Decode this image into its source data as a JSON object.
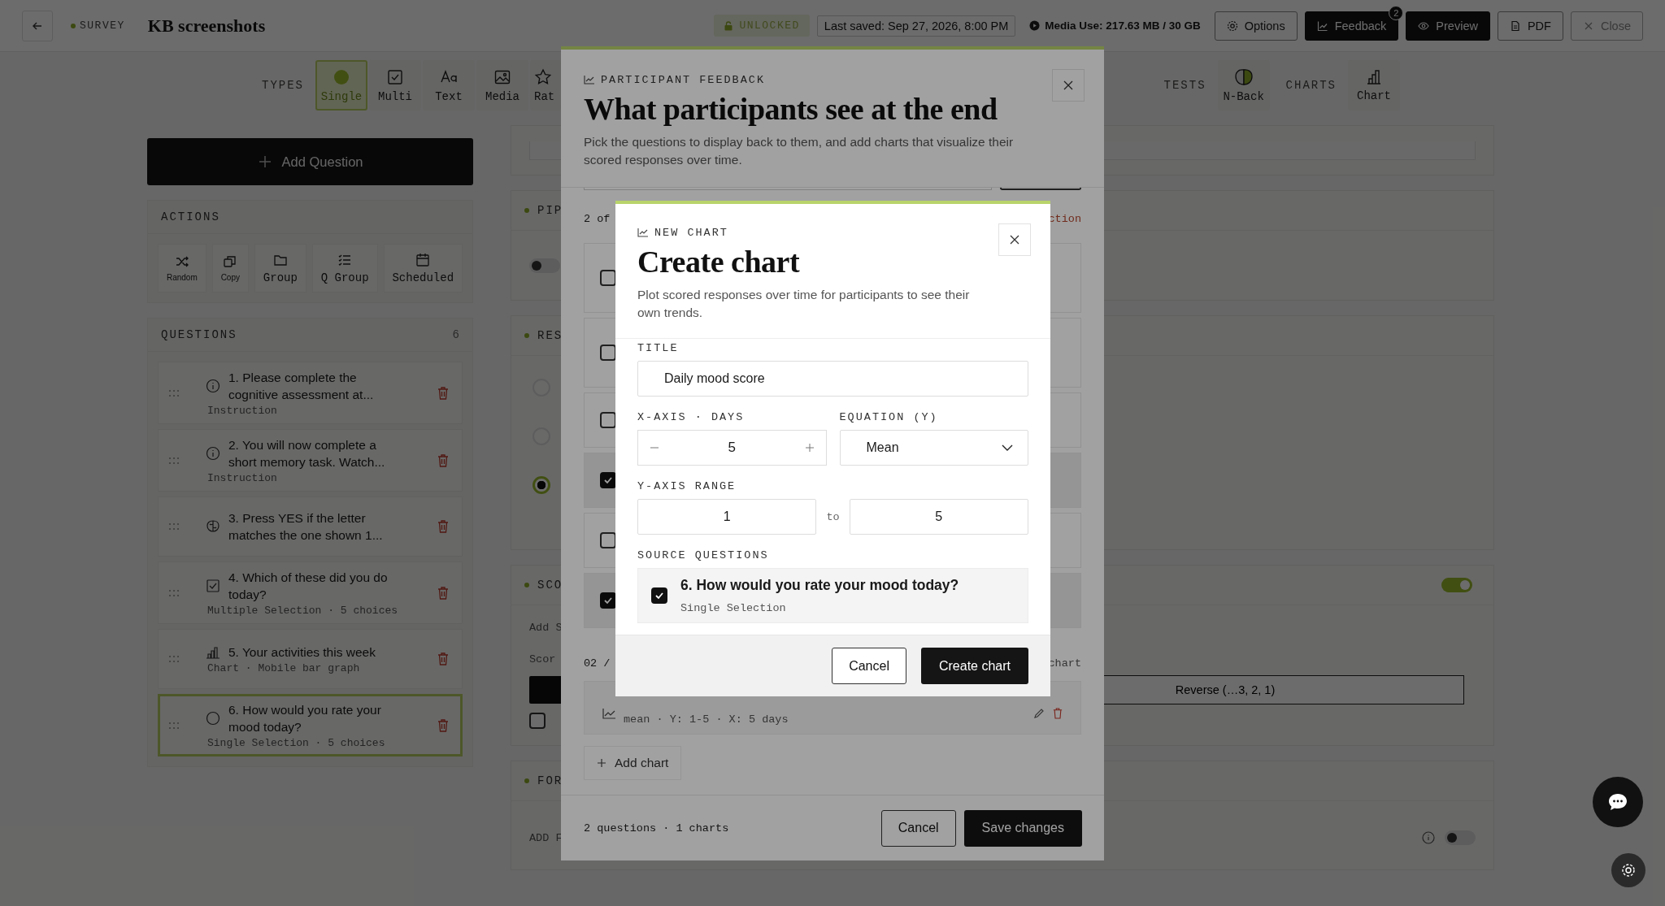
{
  "topbar": {
    "section": "SURVEY",
    "title": "KB screenshots",
    "status": "UNLOCKED",
    "last_saved": "Last saved: Sep 27, 2026, 8:00 PM",
    "media_use": "Media Use: 217.63 MB / 30 GB",
    "buttons": [
      {
        "label": "Options",
        "kind": "outline"
      },
      {
        "label": "Feedback",
        "kind": "dark",
        "badge": "2"
      },
      {
        "label": "Preview",
        "kind": "dark"
      },
      {
        "label": "PDF",
        "kind": "outline"
      },
      {
        "label": "Close",
        "kind": "ghost"
      }
    ]
  },
  "toolbar": {
    "types_label": "TYPES",
    "types": [
      {
        "label": "Single",
        "selected": true
      },
      {
        "label": "Multi",
        "selected": false
      },
      {
        "label": "Text",
        "selected": false
      },
      {
        "label": "Media",
        "selected": false
      },
      {
        "label": "Rat",
        "selected": false
      }
    ],
    "tests_label": "TESTS",
    "tests": [
      {
        "label": "N-Back",
        "selected": false
      }
    ],
    "charts_label": "CHARTS",
    "charts": [
      {
        "label": "Chart",
        "selected": false
      }
    ]
  },
  "sidebar": {
    "add_question": "Add Question",
    "actions_title": "ACTIONS",
    "actions": [
      "Random",
      "Copy",
      "Group",
      "Q Group",
      "Scheduled"
    ],
    "questions_title": "QUESTIONS",
    "questions_count": "6",
    "questions": [
      {
        "title": "1. Please complete the cognitive assessment at...",
        "meta": "Instruction",
        "kind": "instruction",
        "selected": false
      },
      {
        "title": "2. You will now complete a short memory task. Watch...",
        "meta": "Instruction",
        "kind": "instruction",
        "selected": false
      },
      {
        "title": "3. Press YES if the letter matches the one shown 1...",
        "kind": "test",
        "selected": false
      },
      {
        "title": "4. Which of these did you do today?",
        "meta": "Multiple Selection · 5 choices",
        "kind": "multi",
        "selected": false
      },
      {
        "title": "5. Your activities this week",
        "meta": "Chart · Mobile bar graph",
        "kind": "chart",
        "selected": false
      },
      {
        "title": "6. How would you rate your mood today?",
        "meta": "Single Selection · 5 choices",
        "kind": "single",
        "selected": true
      }
    ]
  },
  "panels": {
    "pipeline": {
      "header": "PIP",
      "on": false
    },
    "response": {
      "header": "RES",
      "radios": [
        {
          "selected": false
        },
        {
          "selected": false
        },
        {
          "selected": true
        }
      ]
    },
    "scoring": {
      "header": "SCO",
      "on": true,
      "add_text": "Add S",
      "order_label": "Scor",
      "order_button": "Reverse (…3, 2, 1)",
      "checked": false
    },
    "form": {
      "header": "FOR",
      "add_label": "ADD F",
      "on": false
    }
  },
  "feedback_modal": {
    "eyebrow": "PARTICIPANT FEEDBACK",
    "title": "What participants see at the end",
    "description": "Pick the questions to display back to them, and add charts that visualize their scored responses over time.",
    "count": "2 of",
    "link": "ction",
    "question_rows": [
      {
        "checked": false
      },
      {
        "checked": false
      },
      {
        "checked": false
      },
      {
        "checked": true
      },
      {
        "checked": false
      },
      {
        "checked": true
      }
    ],
    "charts_header": "02 /",
    "charts_link": "chart",
    "charts": [
      {
        "meta": "mean · Y: 1-5 · X: 5 days"
      }
    ],
    "add_chart": "Add chart",
    "summary": "2 questions · 1 charts",
    "cancel": "Cancel",
    "save": "Save changes"
  },
  "chart_modal": {
    "eyebrow": "NEW CHART",
    "title": "Create chart",
    "description": "Plot scored responses over time for participants to see their own trends.",
    "title_label": "TITLE",
    "title_value": "Daily mood score",
    "x_label": "X-AXIS · DAYS",
    "days": "5",
    "equation_label": "EQUATION (Y)",
    "equation": "Mean",
    "y_label": "Y-AXIS RANGE",
    "y_min": "1",
    "to": "to",
    "y_max": "5",
    "source_label": "SOURCE QUESTIONS",
    "sources": [
      {
        "title": "6. How would you rate your mood today?",
        "type": "Single Selection",
        "checked": true
      }
    ],
    "cancel": "Cancel",
    "create": "Create chart"
  }
}
